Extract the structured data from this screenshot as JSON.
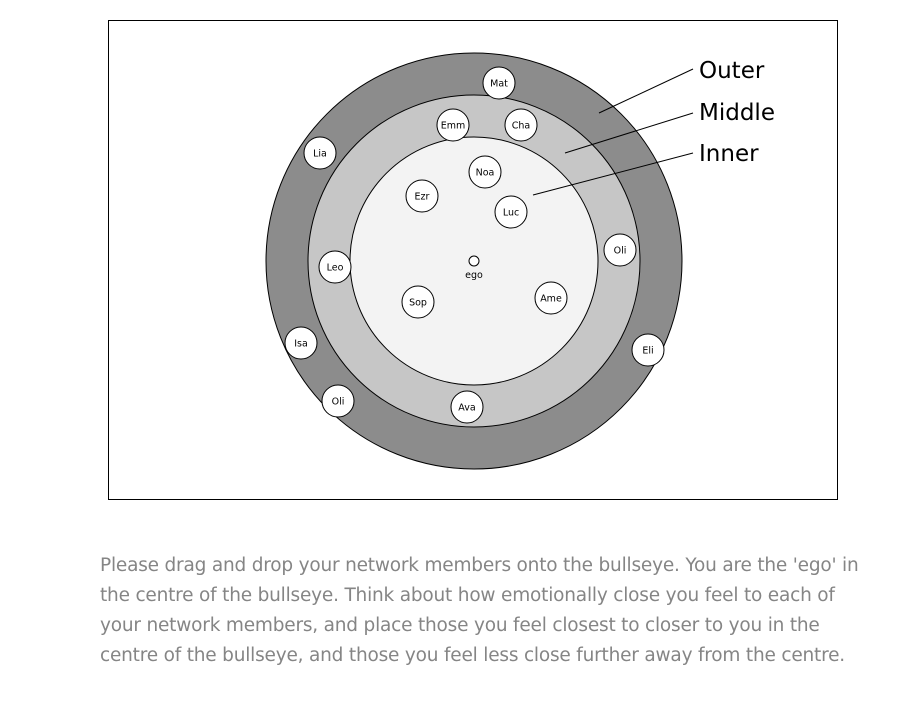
{
  "diagram": {
    "ring_labels": {
      "outer": "Outer",
      "middle": "Middle",
      "inner": "Inner"
    },
    "colors": {
      "outer_ring": "#8c8c8c",
      "middle_ring": "#c6c6c6",
      "inner_ring": "#f3f3f3",
      "node_fill": "#ffffff",
      "stroke": "#000000"
    },
    "ego_label": "ego",
    "members": [
      {
        "label": "Mat",
        "ring": "outer"
      },
      {
        "label": "Lia",
        "ring": "outer"
      },
      {
        "label": "Isa",
        "ring": "outer"
      },
      {
        "label": "Oli",
        "ring": "outer"
      },
      {
        "label": "Eli",
        "ring": "outer"
      },
      {
        "label": "Emm",
        "ring": "middle"
      },
      {
        "label": "Cha",
        "ring": "middle"
      },
      {
        "label": "Leo",
        "ring": "middle"
      },
      {
        "label": "Oli",
        "ring": "middle"
      },
      {
        "label": "Ava",
        "ring": "middle"
      },
      {
        "label": "Noa",
        "ring": "inner"
      },
      {
        "label": "Ezr",
        "ring": "inner"
      },
      {
        "label": "Luc",
        "ring": "inner"
      },
      {
        "label": "Sop",
        "ring": "inner"
      },
      {
        "label": "Ame",
        "ring": "inner"
      }
    ]
  },
  "instructions": "Please drag and drop your network members onto the bullseye. You are the 'ego' in the centre of the bullseye. Think about how emotionally close you feel to each of your network members, and place those you feel closest to closer to you in the centre of the bullseye, and those you feel less close further away from the centre."
}
